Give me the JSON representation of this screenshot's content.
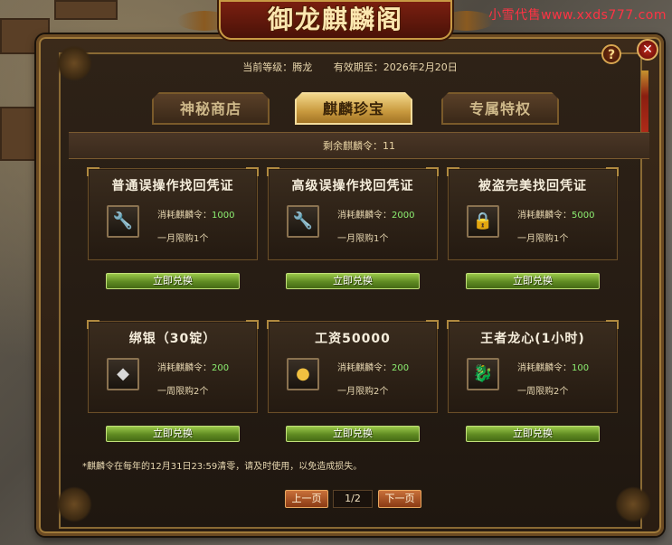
{
  "watermark": "小雪代售www.xxds777.com",
  "window": {
    "title": "御龙麒麟阁",
    "help_label": "?",
    "close_label": "✕"
  },
  "status": {
    "level_label": "当前等级：腾龙",
    "expiry_label": "有效期至：2026年2月20日"
  },
  "tabs": [
    {
      "label": "神秘商店",
      "active": false
    },
    {
      "label": "麒麟珍宝",
      "active": true
    },
    {
      "label": "专属特权",
      "active": false
    }
  ],
  "remaining": "剩余麒麟令：11",
  "cost_prefix": "消耗麒麟令：",
  "items": [
    {
      "title": "普通误操作找回凭证",
      "icon": "wrench-icon",
      "cost": "1000",
      "limit": "一月限购1个",
      "button": "立即兑换"
    },
    {
      "title": "高级误操作找回凭证",
      "icon": "wrench-icon",
      "cost": "2000",
      "limit": "一月限购1个",
      "button": "立即兑换"
    },
    {
      "title": "被盗完美找回凭证",
      "icon": "lock-icon",
      "cost": "5000",
      "limit": "一月限购1个",
      "button": "立即兑换"
    },
    {
      "title": "绑银（30锭）",
      "icon": "silver-ingot-icon",
      "cost": "200",
      "limit": "一周限购2个",
      "button": "立即兑换"
    },
    {
      "title": "工资50000",
      "icon": "gold-coins-icon",
      "cost": "200",
      "limit": "一月限购2个",
      "button": "立即兑换"
    },
    {
      "title": "王者龙心(1小时)",
      "icon": "dragon-head-icon",
      "cost": "100",
      "limit": "一周限购2个",
      "button": "立即兑换"
    }
  ],
  "note": "*麒麟令在每年的12月31日23:59清零，请及时使用，以免造成损失。",
  "pagination": {
    "prev": "上一页",
    "current": "1/2",
    "next": "下一页"
  }
}
